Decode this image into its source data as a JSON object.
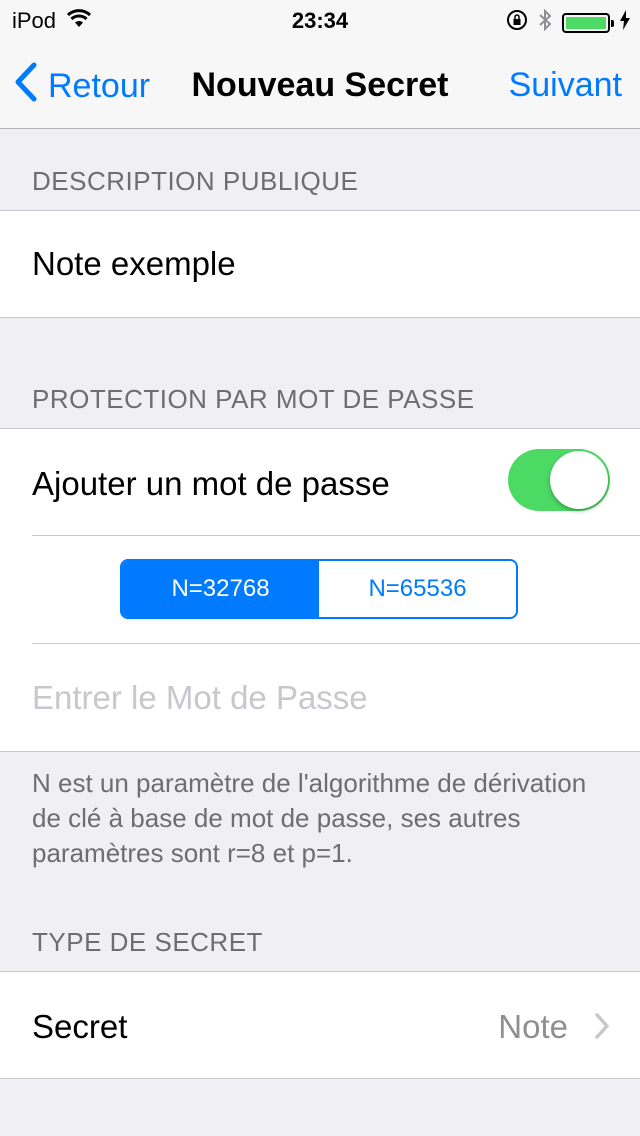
{
  "status_bar": {
    "carrier": "iPod",
    "time": "23:34",
    "battery_color": "#4cd964"
  },
  "nav": {
    "back_label": "Retour",
    "title": "Nouveau Secret",
    "next_label": "Suivant"
  },
  "sections": {
    "public_description": {
      "header": "DESCRIPTION PUBLIQUE",
      "value": "Note exemple"
    },
    "password_protection": {
      "header": "PROTECTION PAR MOT DE PASSE",
      "add_password_label": "Ajouter un mot de passe",
      "add_password_on": true,
      "segments": [
        "N=32768",
        "N=65536"
      ],
      "selected_segment": "N=32768",
      "password_placeholder": "Entrer le Mot de Passe",
      "footer": "N est un paramètre de l'algorithme de dérivation de clé à base de mot de passe, ses autres paramètres sont r=8 et p=1."
    },
    "secret_type": {
      "header": "TYPE DE SECRET",
      "label": "Secret",
      "value": "Note"
    }
  },
  "colors": {
    "accent": "#007aff",
    "toggle_on": "#4cd964",
    "background": "#efeff4"
  }
}
